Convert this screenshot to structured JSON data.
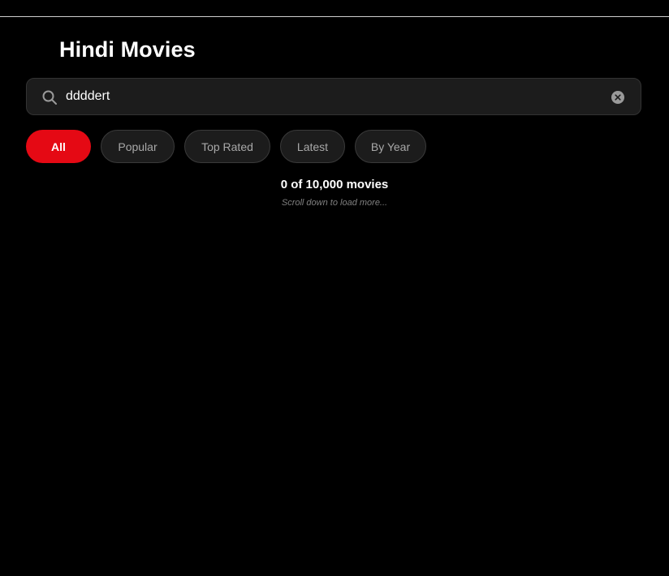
{
  "header": {
    "title": "Hindi Movies"
  },
  "search": {
    "value": "ddddert",
    "icon": "search-icon",
    "clear_icon": "clear-icon"
  },
  "filters": [
    {
      "label": "All",
      "active": true
    },
    {
      "label": "Popular",
      "active": false
    },
    {
      "label": "Top Rated",
      "active": false
    },
    {
      "label": "Latest",
      "active": false
    },
    {
      "label": "By Year",
      "active": false
    }
  ],
  "results": {
    "count_text": "0 of 10,000 movies",
    "hint_text": "Scroll down to load more..."
  },
  "colors": {
    "background": "#000000",
    "accent": "#e50914",
    "chip_bg": "#1c1c1c",
    "search_bg": "#1c1c1c"
  }
}
